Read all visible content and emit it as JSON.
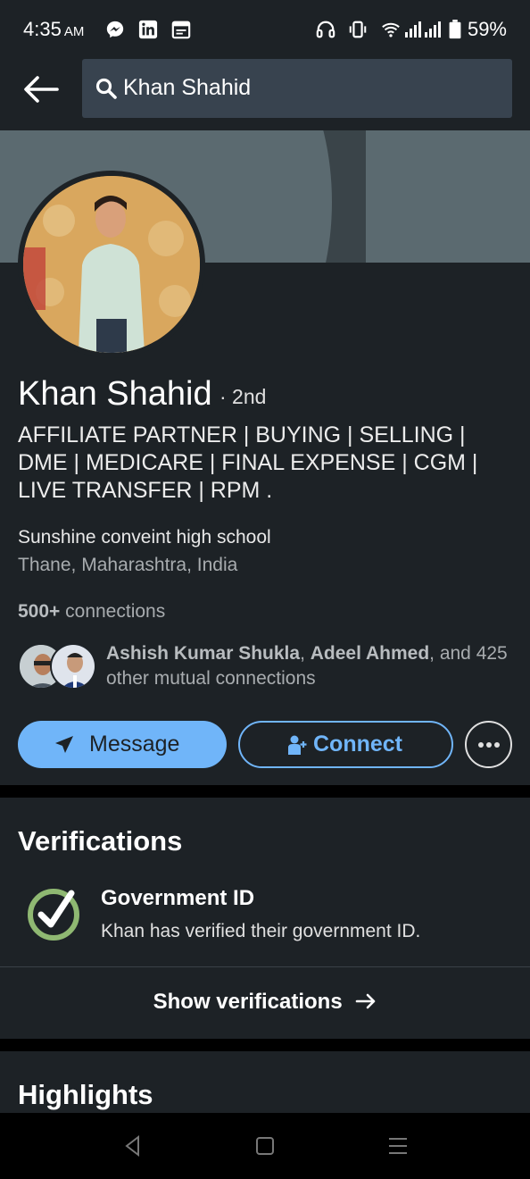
{
  "status_bar": {
    "time": "4:35",
    "ampm": "AM",
    "battery": "59%"
  },
  "search": {
    "value": "Khan Shahid"
  },
  "profile": {
    "name": "Khan Shahid",
    "degree": "· 2nd",
    "headline": "AFFILIATE PARTNER | BUYING | SELLING | DME | MEDICARE | FINAL EXPENSE | CGM | LIVE TRANSFER | RPM .",
    "school": "Sunshine conveint high school",
    "location": "Thane, Maharashtra, India",
    "connections_count": "500+",
    "connections_label": " connections",
    "mutual": {
      "name1": "Ashish Kumar Shukla",
      "sep1": ", ",
      "name2": "Adeel Ahmed",
      "rest": ", and 425 other mutual connections"
    }
  },
  "actions": {
    "message": "Message",
    "connect": "Connect"
  },
  "verifications": {
    "title": "Verifications",
    "item_title": "Government ID",
    "item_desc": "Khan has verified their government ID.",
    "show_label": "Show verifications"
  },
  "highlights": {
    "title": "Highlights"
  },
  "colors": {
    "background": "#1d2226",
    "accent": "#70b5f9",
    "verified_green": "#8fb872"
  },
  "icons": [
    "messenger-icon",
    "linkedin-icon",
    "calendar-icon",
    "headphones-icon",
    "vibrate-icon",
    "wifi-icon",
    "signal-icon",
    "battery-icon",
    "back-arrow-icon",
    "search-icon",
    "send-icon",
    "add-person-icon",
    "more-icon",
    "check-circle-icon",
    "arrow-right-icon"
  ]
}
